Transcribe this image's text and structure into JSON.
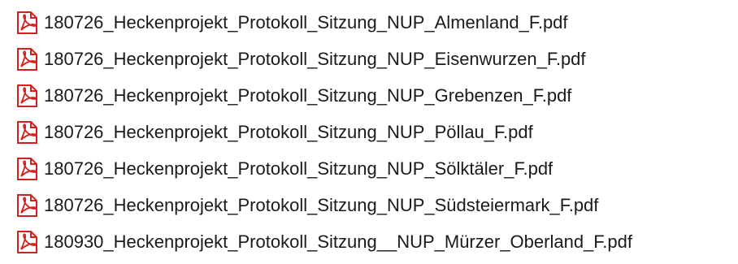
{
  "files": [
    {
      "name": "180726_Heckenprojekt_Protokoll_Sitzung_NUP_Almenland_F.pdf",
      "icon": "pdf-icon"
    },
    {
      "name": "180726_Heckenprojekt_Protokoll_Sitzung_NUP_Eisenwurzen_F.pdf",
      "icon": "pdf-icon"
    },
    {
      "name": "180726_Heckenprojekt_Protokoll_Sitzung_NUP_Grebenzen_F.pdf",
      "icon": "pdf-icon"
    },
    {
      "name": "180726_Heckenprojekt_Protokoll_Sitzung_NUP_Pöllau_F.pdf",
      "icon": "pdf-icon"
    },
    {
      "name": "180726_Heckenprojekt_Protokoll_Sitzung_NUP_Sölktäler_F.pdf",
      "icon": "pdf-icon"
    },
    {
      "name": "180726_Heckenprojekt_Protokoll_Sitzung_NUP_Südsteiermark_F.pdf",
      "icon": "pdf-icon"
    },
    {
      "name": "180930_Heckenprojekt_Protokoll_Sitzung__NUP_Mürzer_Oberland_F.pdf",
      "icon": "pdf-icon"
    }
  ],
  "colors": {
    "pdf_red": "#d4201c",
    "text": "#1a1a1a"
  }
}
